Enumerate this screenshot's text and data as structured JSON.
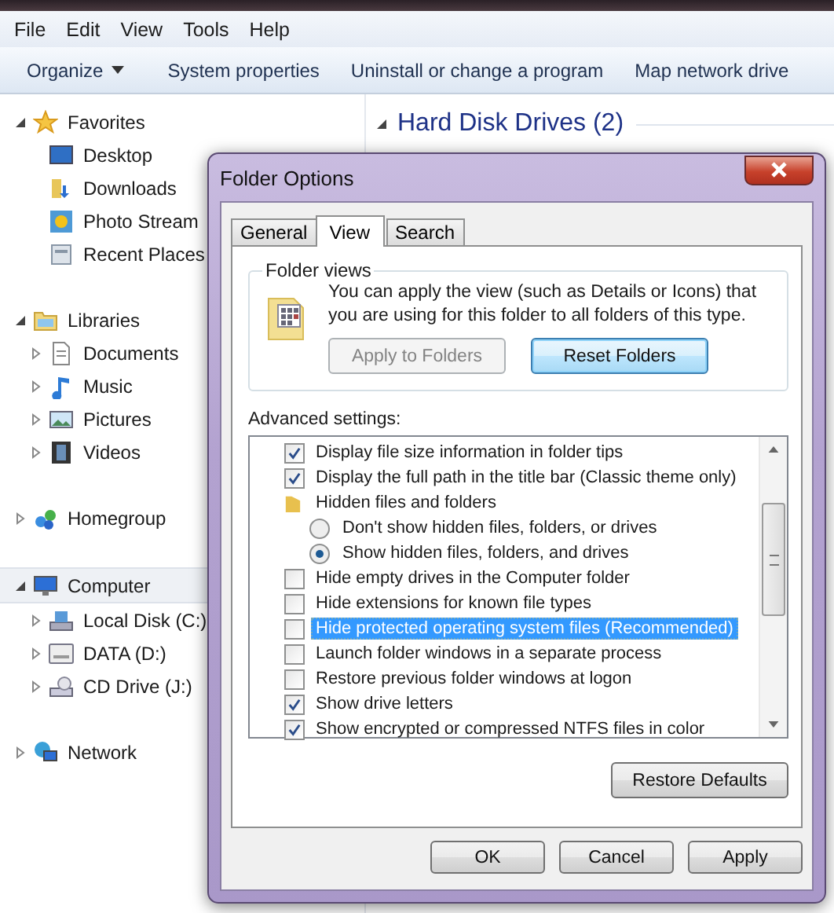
{
  "menu": [
    "File",
    "Edit",
    "View",
    "Tools",
    "Help"
  ],
  "toolbar": [
    {
      "label": "Organize",
      "has_menu": true
    },
    {
      "label": "System properties",
      "has_menu": false
    },
    {
      "label": "Uninstall or change a program",
      "has_menu": false
    },
    {
      "label": "Map network drive",
      "has_menu": false
    }
  ],
  "nav_tree": [
    {
      "label": "Favorites",
      "expanded": true,
      "selected": false,
      "children": [
        {
          "label": "Desktop"
        },
        {
          "label": "Downloads"
        },
        {
          "label": "Photo Stream"
        },
        {
          "label": "Recent Places"
        }
      ]
    },
    {
      "label": "Libraries",
      "expanded": true,
      "selected": false,
      "children": [
        {
          "label": "Documents",
          "expanded": false
        },
        {
          "label": "Music",
          "expanded": false
        },
        {
          "label": "Pictures",
          "expanded": false
        },
        {
          "label": "Videos",
          "expanded": false
        }
      ]
    },
    {
      "label": "Homegroup",
      "expanded": false,
      "selected": false
    },
    {
      "label": "Computer",
      "expanded": true,
      "selected": true,
      "children": [
        {
          "label": "Local Disk (C:)",
          "expanded": false
        },
        {
          "label": "DATA (D:)",
          "expanded": false
        },
        {
          "label": "CD Drive (J:)",
          "expanded": false
        }
      ]
    },
    {
      "label": "Network",
      "expanded": false,
      "selected": false
    }
  ],
  "content": {
    "group_title": "Hard Disk Drives (2)",
    "expanded": true
  },
  "dialog": {
    "title": "Folder Options",
    "tabs": [
      {
        "label": "General",
        "selected": false
      },
      {
        "label": "View",
        "selected": true
      },
      {
        "label": "Search",
        "selected": false
      }
    ],
    "folder_views": {
      "legend": "Folder views",
      "description": "You can apply the view (such as Details or Icons) that you are using for this folder to all folders of this type.",
      "buttons": [
        {
          "label": "Apply to Folders",
          "disabled": true
        },
        {
          "label": "Reset Folders",
          "disabled": false
        }
      ]
    },
    "advanced_label": "Advanced settings:",
    "settings": [
      {
        "kind": "checkbox",
        "label": "Display file size information in folder tips",
        "checked": true,
        "selected": false
      },
      {
        "kind": "checkbox",
        "label": "Display the full path in the title bar (Classic theme only)",
        "checked": true,
        "selected": false
      },
      {
        "kind": "folder",
        "label": "Hidden files and folders",
        "selected": false
      },
      {
        "kind": "radio",
        "label": "Don't show hidden files, folders, or drives",
        "checked": false,
        "selected": false
      },
      {
        "kind": "radio",
        "label": "Show hidden files, folders, and drives",
        "checked": true,
        "selected": false
      },
      {
        "kind": "checkbox",
        "label": "Hide empty drives in the Computer folder",
        "checked": false,
        "selected": false
      },
      {
        "kind": "checkbox",
        "label": "Hide extensions for known file types",
        "checked": false,
        "selected": false
      },
      {
        "kind": "checkbox",
        "label": "Hide protected operating system files (Recommended)",
        "checked": false,
        "selected": true
      },
      {
        "kind": "checkbox",
        "label": "Launch folder windows in a separate process",
        "checked": false,
        "selected": false
      },
      {
        "kind": "checkbox",
        "label": "Restore previous folder windows at logon",
        "checked": false,
        "selected": false
      },
      {
        "kind": "checkbox",
        "label": "Show drive letters",
        "checked": true,
        "selected": false
      },
      {
        "kind": "checkbox",
        "label": "Show encrypted or compressed NTFS files in color",
        "checked": true,
        "selected": false
      }
    ],
    "restore_button": "Restore Defaults",
    "buttons": [
      "OK",
      "Cancel",
      "Apply"
    ]
  }
}
